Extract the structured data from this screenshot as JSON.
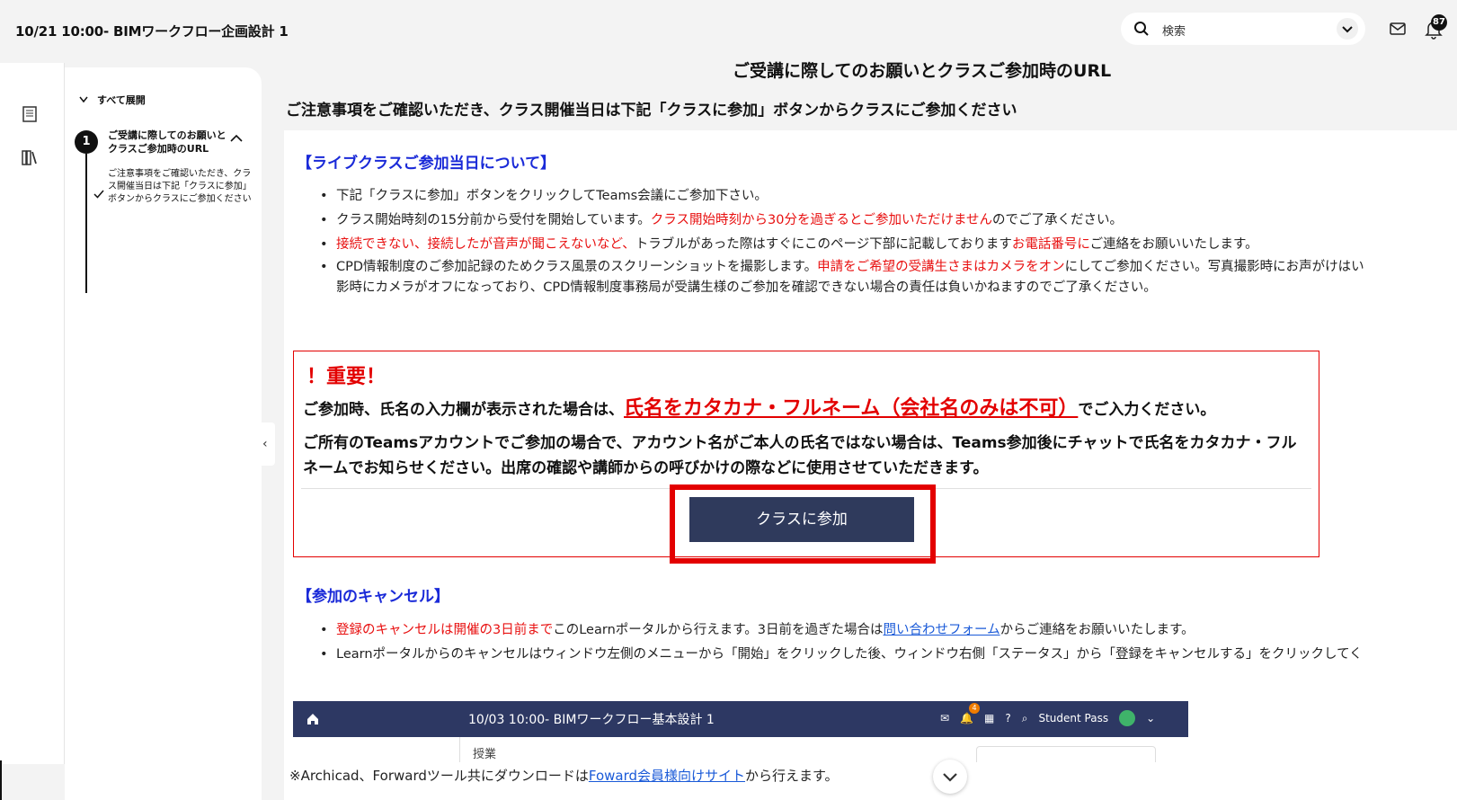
{
  "header": {
    "course_title": "10/21 10:00- BIMワークフロー企画設計 1",
    "search_placeholder": "検索",
    "notification_count": "87"
  },
  "sidebar": {
    "expand_all": "すべて展開",
    "step_number": "1",
    "step_title": "ご受講に際してのお願いとクラスご参加時のURL",
    "sub_item": "ご注意事項をご確認いただき、クラス開催当日は下記「クラスに参加」ボタンからクラスにご参加ください"
  },
  "main": {
    "title": "ご受講に際してのお願いとクラスご参加時のURL",
    "subtitle": "ご注意事項をご確認いただき、クラス開催当日は下記「クラスに参加」ボタンからクラスにご参加ください",
    "live": {
      "heading": "【ライブクラスご参加当日について】",
      "b1": "下記「クラスに参加」ボタンをクリックしてTeams会議にご参加下さい。",
      "b2_a": "クラス開始時刻の15分前から受付を開始しています。",
      "b2_red": "クラス開始時刻から30分を過ぎるとご参加いただけません",
      "b2_b": "のでご了承ください。",
      "b3_red": "接続できない、接続したが音声が聞こえないなど、",
      "b3_a": "トラブルがあった際はすぐにこのページ下部に記載しております",
      "b3_red2": "お電話番号に",
      "b3_b": "ご連絡をお願いいたします。",
      "b4_a": "CPD情報制度のご参加記録のためクラス風景のスクリーンショットを撮影します。",
      "b4_red": "申請をご希望の受講生さまはカメラをオン",
      "b4_b": "にしてご参加ください。写真撮影時にお声がけはい",
      "b4_c": "影時にカメラがオフになっており、CPD情報制度事務局が受講生様のご参加を確認できない場合の責任は負いかねますのでご了承ください。"
    },
    "important": {
      "title": "！重要！",
      "l1_a": "ご参加時、氏名の入力欄が表示された場合は、",
      "l1_big": "氏名をカタカナ・フルネーム（会社名のみは不可）",
      "l1_b": "でご入力ください。",
      "l2": "ご所有のTeamsアカウントでご参加の場合で、アカウント名がご本人の氏名ではない場合は、Teams参加後にチャットで氏名をカタカナ・フルネームでお知らせください。出席の確認や講師からの呼びかけの際などに使用させていただきます。",
      "join_button": "クラスに参加"
    },
    "cancel": {
      "heading": "【参加のキャンセル】",
      "b1_red": "登録のキャンセルは開催の3日前まで",
      "b1_a": "このLearnポータルから行えます。3日前を過ぎた場合は",
      "b1_link": "問い合わせフォーム",
      "b1_b": "からご連絡をお願いいたします。",
      "b2": "Learnポータルからのキャンセルはウィンドウ左側のメニューから「開始」をクリックした後、ウィンドウ右側「ステータス」から「登録をキャンセルする」をクリックしてく"
    },
    "embed": {
      "title": "10/03 10:00- BIMワークフロー基本設計 1",
      "user": "Student Pass",
      "badge": "4",
      "sub_label": "授業"
    },
    "note": {
      "a": "※Archicad、Forwardツール共にダウンロードは",
      "link": "Foward会員様向けサイト",
      "b": "から行えます。"
    }
  }
}
